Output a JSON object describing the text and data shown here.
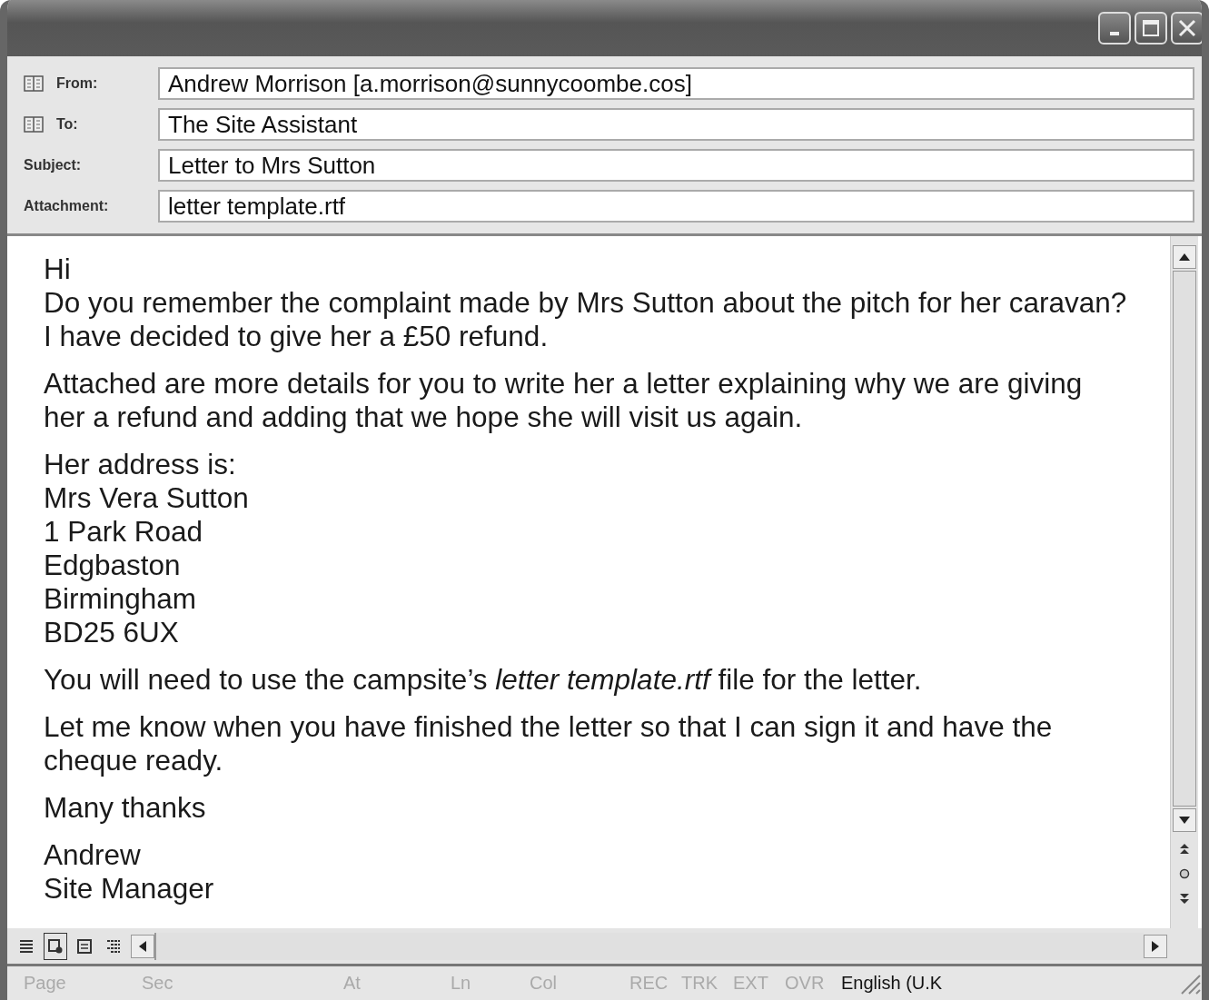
{
  "header_fields": [
    {
      "kind": "address",
      "label": "From:",
      "value": "Andrew Morrison [a.morrison@sunnycoombe.cos]"
    },
    {
      "kind": "address",
      "label": "To:",
      "value": "The Site Assistant"
    },
    {
      "kind": "plain",
      "label": "Subject:",
      "value": "Letter to Mrs Sutton"
    },
    {
      "kind": "plain",
      "label": "Attachment:",
      "value": "letter template.rtf"
    }
  ],
  "body_paragraphs": [
    {
      "lines": [
        "Hi",
        "Do you remember the complaint made by Mrs Sutton about the pitch for her caravan?",
        "I have decided to give her a £50 refund."
      ]
    },
    {
      "lines": [
        "Attached are more details for you to write her a letter explaining why we are giving",
        "her a refund and adding that we hope she will visit us again."
      ]
    },
    {
      "lines": [
        "Her address is:",
        "Mrs Vera Sutton",
        "1 Park Road",
        "Edgbaston",
        "Birmingham",
        "BD25 6UX"
      ]
    },
    {
      "lines": [
        "You will need to use the campsite’s *letter template.rtf* file for the letter."
      ]
    },
    {
      "lines": [
        "Let me know when you have finished the letter so that I can sign it and have the",
        "cheque ready."
      ]
    },
    {
      "lines": [
        "Many thanks"
      ]
    },
    {
      "lines": [
        "Andrew",
        "Site Manager"
      ]
    }
  ],
  "view_buttons": [
    {
      "selected": false
    },
    {
      "selected": true
    },
    {
      "selected": false
    },
    {
      "selected": false
    }
  ],
  "status_bar": [
    {
      "text": "Page",
      "disabled": true
    },
    {
      "text": "Sec",
      "disabled": true
    },
    {
      "text": "At",
      "disabled": true
    },
    {
      "text": "Ln",
      "disabled": true
    },
    {
      "text": "Col",
      "disabled": true
    },
    {
      "text": "REC",
      "disabled": true
    },
    {
      "text": "TRK",
      "disabled": true
    },
    {
      "text": "EXT",
      "disabled": true
    },
    {
      "text": "OVR",
      "disabled": true
    },
    {
      "text": "English (U.K",
      "disabled": false
    }
  ]
}
